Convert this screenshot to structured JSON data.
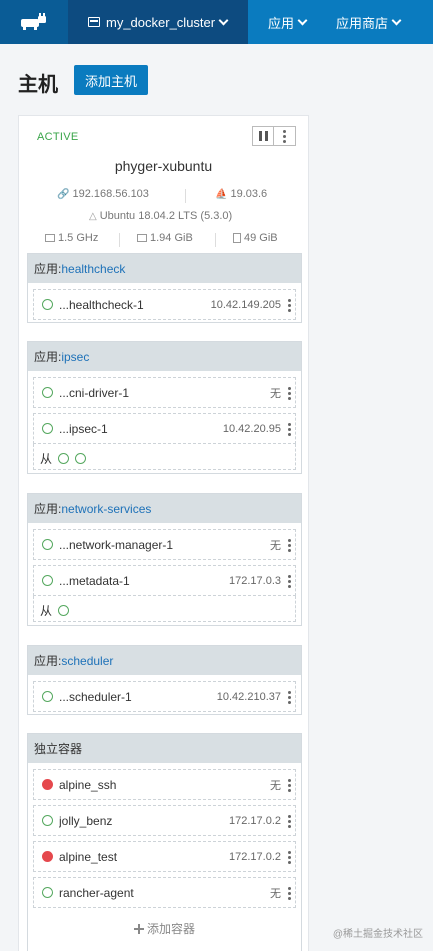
{
  "topbar": {
    "env_name": "my_docker_cluster",
    "nav_apps": "应用",
    "nav_catalog": "应用商店"
  },
  "page": {
    "title": "主机",
    "add_host": "添加主机"
  },
  "host": {
    "state": "ACTIVE",
    "name": "phyger-xubuntu",
    "ip": "192.168.56.103",
    "docker_version": "19.03.6",
    "os": "Ubuntu 18.04.2 LTS (5.3.0)",
    "cpu": "1.5 GHz",
    "memory": "1.94 GiB",
    "disk": "49 GiB"
  },
  "stacks": [
    {
      "prefix": "应用: ",
      "name": "healthcheck",
      "services": [
        {
          "name": "...healthcheck-1",
          "ip": "10.42.149.205",
          "status": "ok"
        }
      ]
    },
    {
      "prefix": "应用: ",
      "name": "ipsec",
      "services": [
        {
          "name": "...cni-driver-1",
          "ip": "无",
          "status": "ok"
        },
        {
          "name": "...ipsec-1",
          "ip": "10.42.20.95",
          "status": "ok"
        }
      ],
      "sidekick_label": "从"
    },
    {
      "prefix": "应用: ",
      "name": "network-services",
      "services": [
        {
          "name": "...network-manager-1",
          "ip": "无",
          "status": "ok"
        },
        {
          "name": "...metadata-1",
          "ip": "172.17.0.3",
          "status": "ok"
        }
      ],
      "sidekick_label": "从"
    },
    {
      "prefix": "应用: ",
      "name": "scheduler",
      "services": [
        {
          "name": "...scheduler-1",
          "ip": "10.42.210.37",
          "status": "ok"
        }
      ]
    }
  ],
  "standalone": {
    "title": "独立容器",
    "containers": [
      {
        "name": "alpine_ssh",
        "ip": "无",
        "status": "stopped"
      },
      {
        "name": "jolly_benz",
        "ip": "172.17.0.2",
        "status": "ok"
      },
      {
        "name": "alpine_test",
        "ip": "172.17.0.2",
        "status": "stopped"
      },
      {
        "name": "rancher-agent",
        "ip": "无",
        "status": "ok"
      }
    ],
    "add_label": "添加容器"
  },
  "watermark": "@稀土掘金技术社区",
  "colors": {
    "primary": "#0a7bbf",
    "dark": "#0d4b80",
    "active": "#3aa54a",
    "stopped": "#e5484d"
  }
}
